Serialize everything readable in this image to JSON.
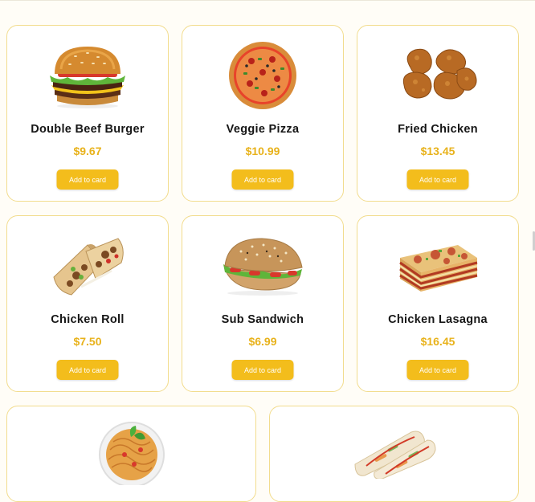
{
  "products": [
    {
      "name": "Double Beef Burger",
      "price": "$9.67",
      "button": "Add to card",
      "icon": "burger-icon"
    },
    {
      "name": "Veggie Pizza",
      "price": "$10.99",
      "button": "Add to card",
      "icon": "pizza-icon"
    },
    {
      "name": "Fried Chicken",
      "price": "$13.45",
      "button": "Add to card",
      "icon": "fried-chicken-icon"
    },
    {
      "name": "Chicken Roll",
      "price": "$7.50",
      "button": "Add to card",
      "icon": "wrap-icon"
    },
    {
      "name": "Sub Sandwich",
      "price": "$6.99",
      "button": "Add to card",
      "icon": "sandwich-icon"
    },
    {
      "name": "Chicken Lasagna",
      "price": "$16.45",
      "button": "Add to card",
      "icon": "lasagna-icon"
    },
    {
      "icon": "spaghetti-icon"
    },
    {
      "icon": "spring-rolls-icon"
    }
  ],
  "colors": {
    "accent": "#f3bd1c",
    "price": "#e8b21b",
    "border": "#f2dc8d",
    "background": "#fffdf7"
  }
}
